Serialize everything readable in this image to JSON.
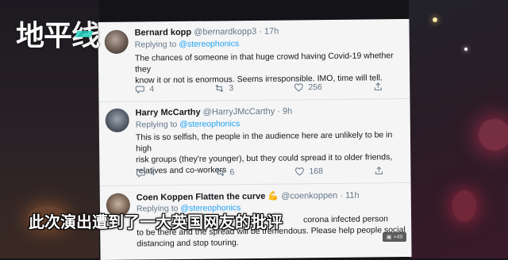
{
  "overlay": {
    "logo_main": "地平",
    "logo_accent": "线",
    "caption": "此次演出遭到了一大英国网友的批评",
    "badge": "+49"
  },
  "tweets": [
    {
      "name": "Bernard kopp",
      "handle": "@bernardkopp3 · 17h",
      "reply_prefix": "Replying to ",
      "reply_to": "@stereophonics",
      "lines": [
        "The chances of someone in that huge crowd having Covid-19 whether they",
        "know it or not is enormous. Seems irresponsible. IMO, time will tell."
      ],
      "replies": "4",
      "retweets": "3",
      "likes": "256"
    },
    {
      "name": "Harry McCarthy",
      "handle": "@HarryJMcCarthy · 9h",
      "reply_prefix": "Replying to ",
      "reply_to": "@stereophonics",
      "lines": [
        "This is so selfish, the people in the audience here are unlikely to be in high",
        "risk groups (they're younger), but they could spread it to older friends,",
        "relatives and co-workers"
      ],
      "replies": "4",
      "retweets": "6",
      "likes": "168"
    },
    {
      "name": "Coen Koppen Flatten the curve",
      "emoji": "💪",
      "handle": "@coenkoppen · 11h",
      "reply_prefix": "Replying to ",
      "reply_to": "@stereophonics",
      "lines": [
        "corona infected person",
        "to be there and the spread will be tremendous. Please help people social",
        "distancing and stop touring."
      ]
    }
  ]
}
